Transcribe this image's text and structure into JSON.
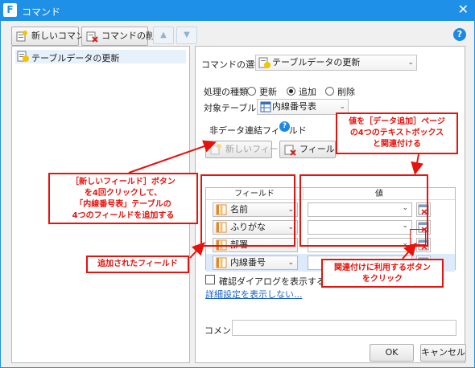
{
  "window": {
    "title": "コマンド",
    "app_icon_letter": "F"
  },
  "toolbar": {
    "new_command": "新しいコマンド",
    "delete_command": "コマンドの削除"
  },
  "command_list": {
    "items": [
      "テーブルデータの更新"
    ]
  },
  "form": {
    "command_select_label": "コマンドの選択：",
    "command_select_value": "テーブルデータの更新",
    "process_type_label": "処理の種類",
    "radio_update": "更新",
    "radio_add": "追加",
    "radio_delete": "削除",
    "target_table_label": "対象テーブル：",
    "target_table_value": "内線番号表",
    "non_data_field_label": "非データ連結フィールド",
    "new_field_button": "新しいフィールド",
    "field_delete_button": "フィールドの削除",
    "col_field": "フィールド",
    "col_value": "値",
    "fields": [
      "名前",
      "ふりがな",
      "部署",
      "内線番号"
    ],
    "confirm_dialog": "確認ダイアログを表示する",
    "advanced_link": "詳細設定を表示しない...",
    "comment_label": "コメント",
    "comment_value": ""
  },
  "footer": {
    "ok": "OK",
    "cancel": "キャンセル"
  },
  "annotations": {
    "left_callout": "［新しいフィールド］ボタン\nを4回クリックして、\n「内線番号表」テーブルの\n4つのフィールドを追加する",
    "added_fields": "追加されたフィールド",
    "top_right": "値を［データ追加］ページ\nの4つのテキストボックス\nと関連付ける",
    "bottom_right": "関連付けに利用するボタン\nをクリック"
  },
  "colors": {
    "accent": "#1e90e8",
    "annotation": "#e8120c",
    "selected_row": "#dcebfb"
  }
}
